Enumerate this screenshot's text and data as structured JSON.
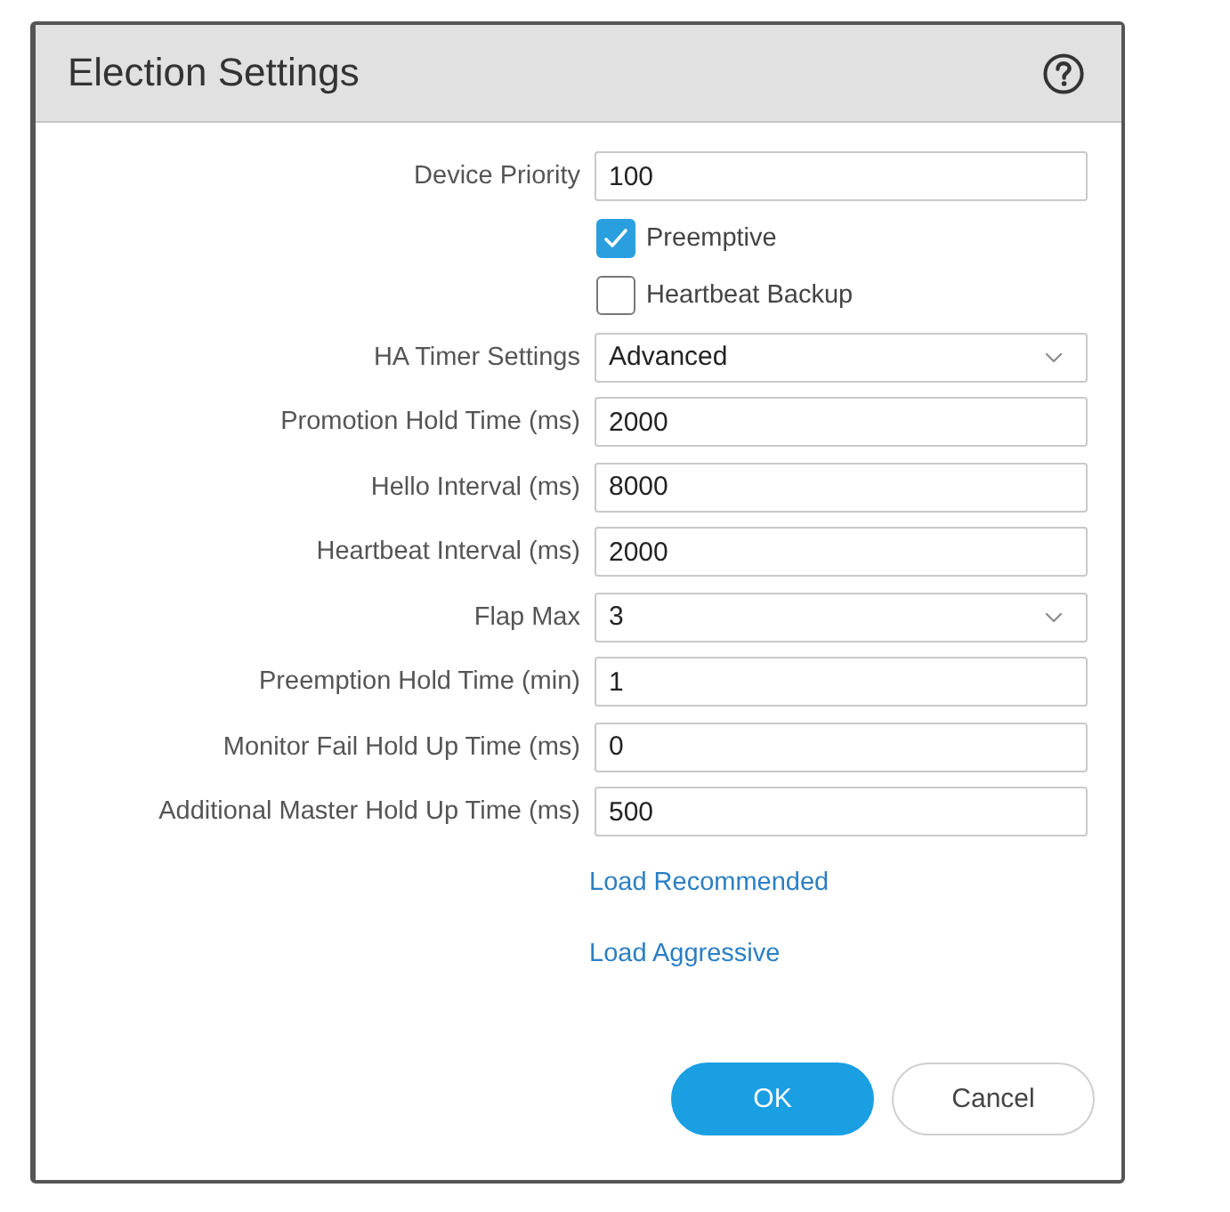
{
  "dialog": {
    "title": "Election Settings"
  },
  "fields": [
    {
      "kind": "text",
      "label": "Device Priority",
      "value": "100"
    },
    {
      "kind": "checkbox",
      "label": "Preemptive",
      "checked": true
    },
    {
      "kind": "checkbox",
      "label": "Heartbeat Backup",
      "checked": false
    },
    {
      "kind": "select",
      "label": "HA Timer Settings",
      "value": "Advanced"
    },
    {
      "kind": "text",
      "label": "Promotion Hold Time (ms)",
      "value": "2000"
    },
    {
      "kind": "text",
      "label": "Hello Interval (ms)",
      "value": "8000"
    },
    {
      "kind": "text",
      "label": "Heartbeat Interval (ms)",
      "value": "2000"
    },
    {
      "kind": "select",
      "label": "Flap Max",
      "value": "3"
    },
    {
      "kind": "text",
      "label": "Preemption Hold Time (min)",
      "value": "1"
    },
    {
      "kind": "text",
      "label": "Monitor Fail Hold Up Time (ms)",
      "value": "0"
    },
    {
      "kind": "text",
      "label": "Additional Master Hold Up Time (ms)",
      "value": "500"
    }
  ],
  "links": [
    "Load Recommended",
    "Load Aggressive"
  ],
  "buttons": [
    {
      "label": "OK",
      "kind": "primary"
    },
    {
      "label": "Cancel",
      "kind": "secondary"
    }
  ]
}
